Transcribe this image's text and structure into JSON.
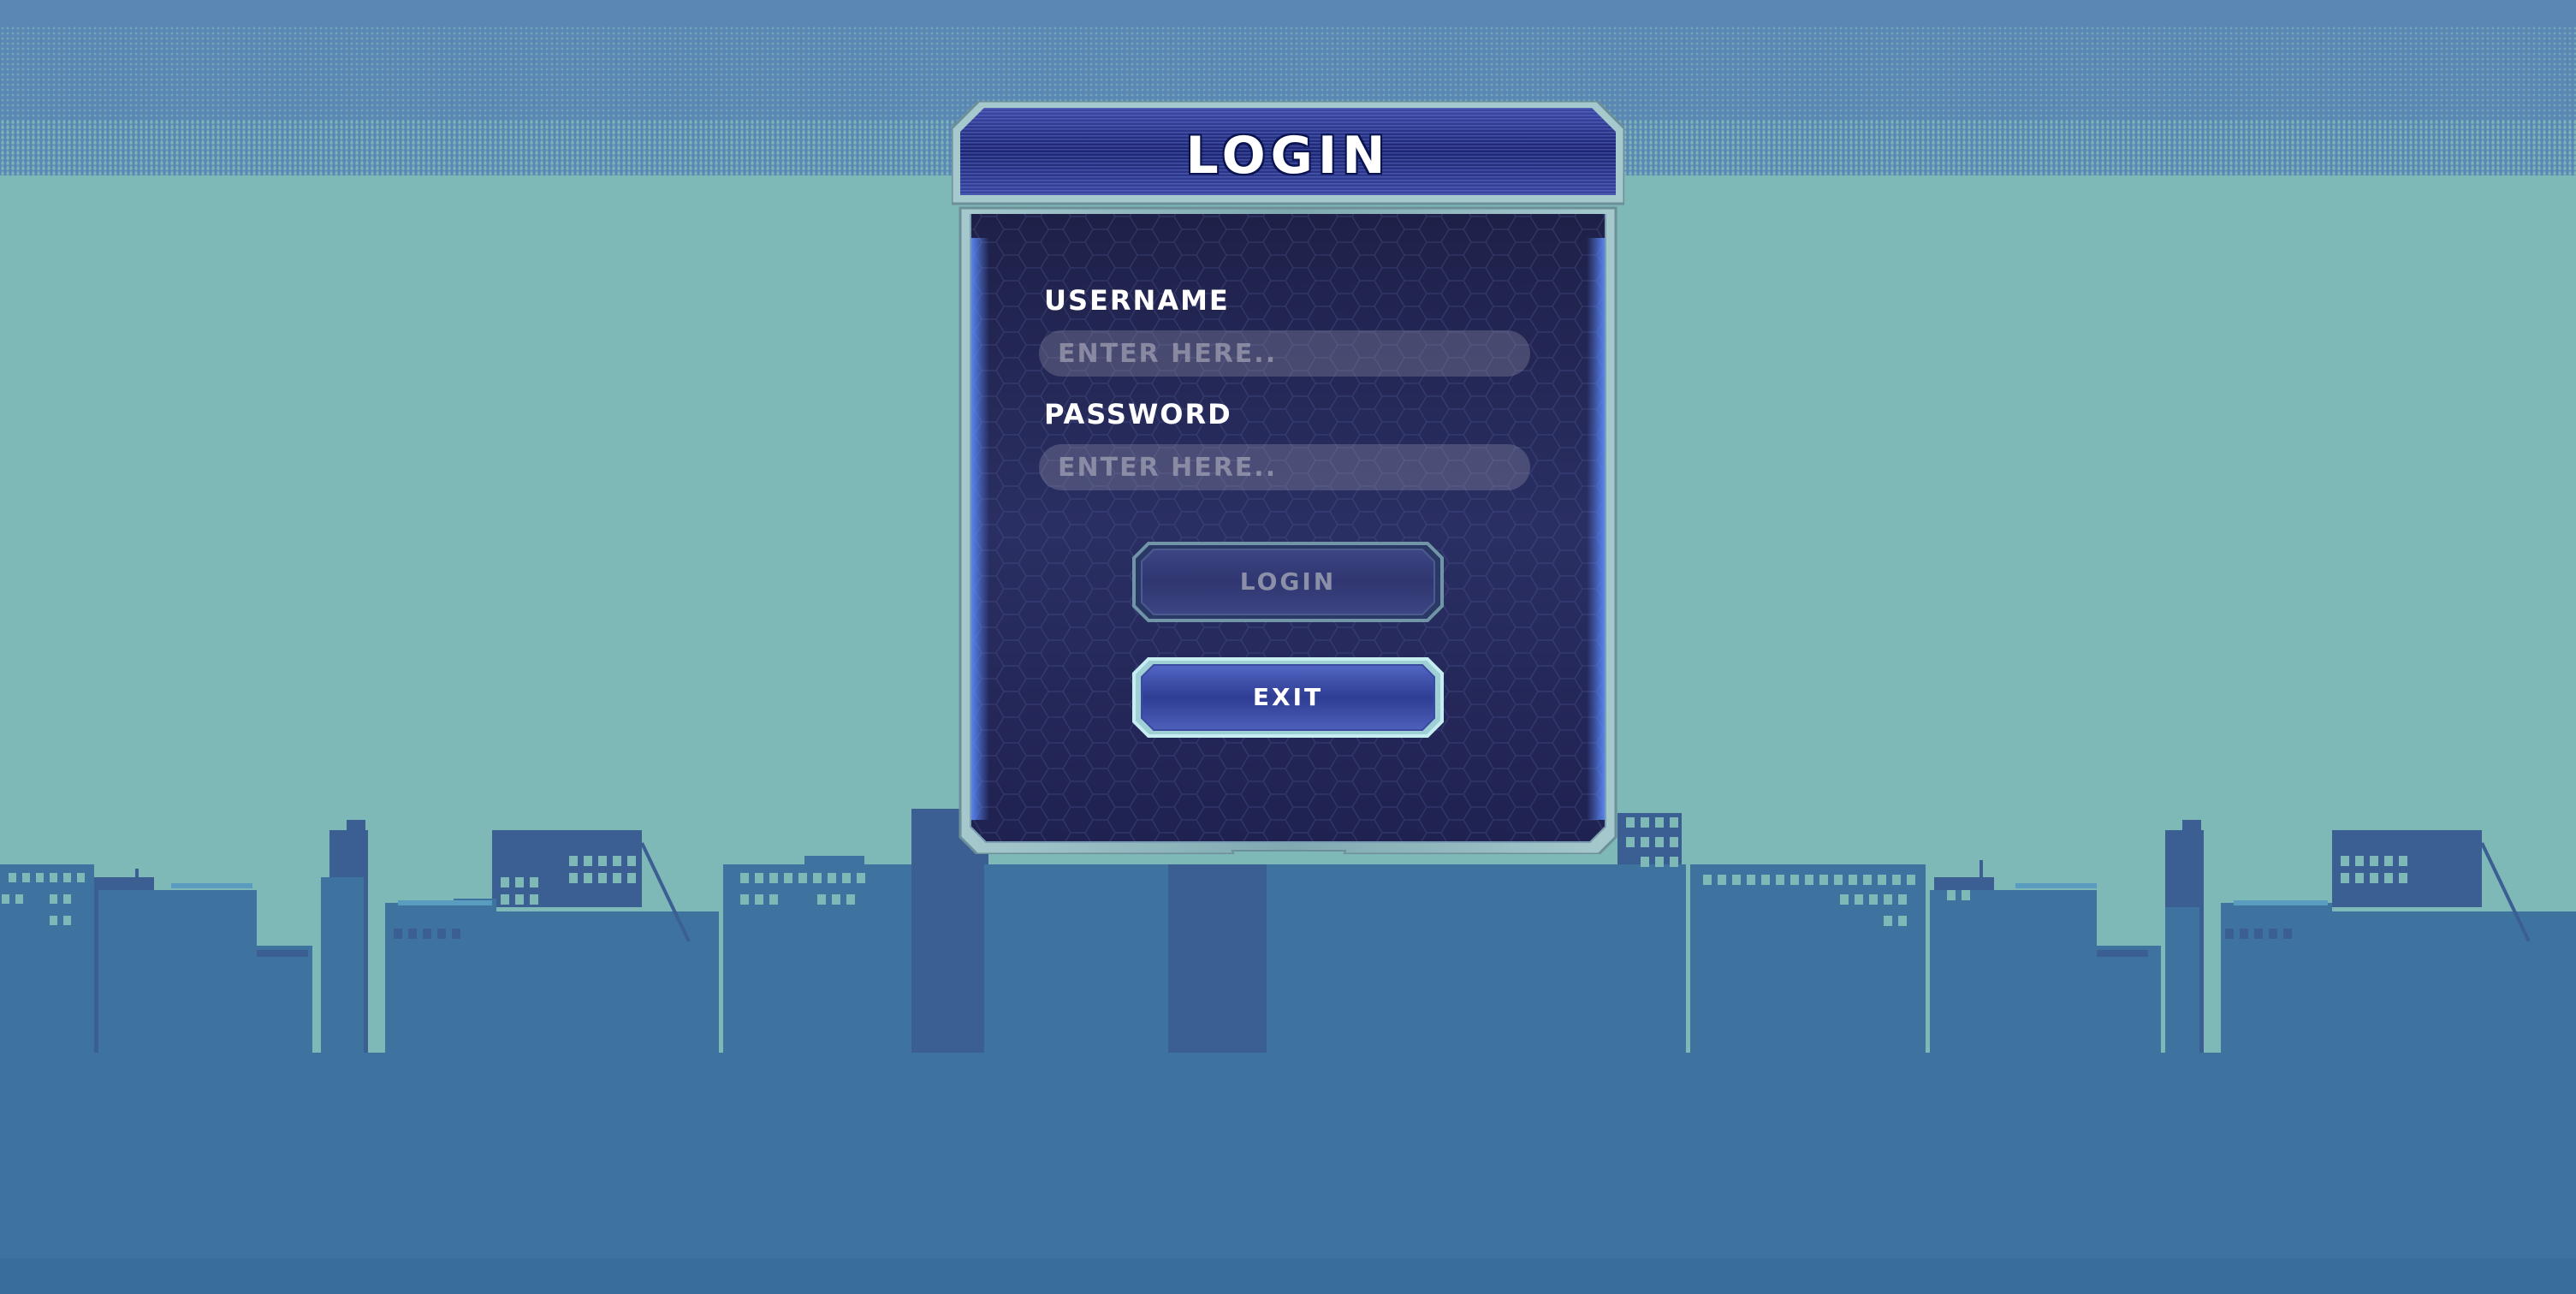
{
  "screen": {
    "title": "LOGIN"
  },
  "form": {
    "username_label": "USERNAME",
    "username_placeholder": "ENTER HERE..",
    "username_value": "",
    "password_label": "PASSWORD",
    "password_placeholder": "ENTER HERE..",
    "password_value": ""
  },
  "buttons": {
    "login_label": "LOGIN",
    "login_state": "disabled",
    "exit_label": "EXIT"
  },
  "icons": {
    "panel_frame": "sci-fi-frame",
    "background": "city-skyline"
  },
  "colors": {
    "sky_top": "#5a87b4",
    "sky": "#7eb8b7",
    "buildings_front": "#3e73a0",
    "buildings_back": "#3b5f93",
    "panel_bg": "#25274f",
    "header_bg": "#2a3584",
    "frame": "#9bc2c8",
    "accent_glow": "#4d7dff"
  }
}
